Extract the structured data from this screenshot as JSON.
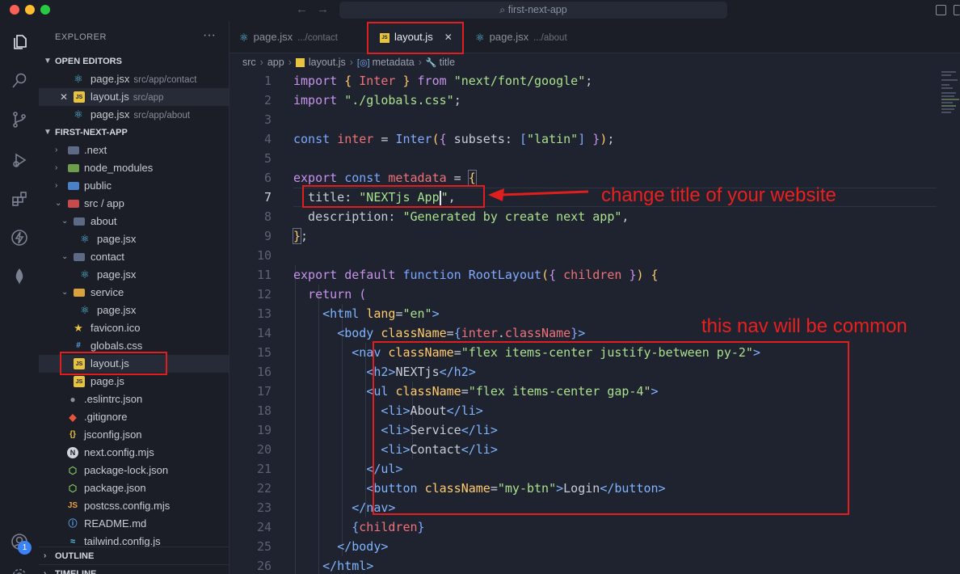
{
  "window": {
    "search_text": "first-next-app"
  },
  "activity_bar": {
    "icons": [
      "explorer-icon",
      "search-icon",
      "source-control-icon",
      "run-debug-icon",
      "extensions-icon",
      "thunder-icon",
      "mongodb-icon",
      "account-icon",
      "settings-icon"
    ],
    "badge": "1"
  },
  "explorer": {
    "title": "EXPLORER",
    "more": "···",
    "open_editors": {
      "label": "OPEN EDITORS",
      "items": [
        {
          "name": "page.jsx",
          "path": "src/app/contact"
        },
        {
          "name": "layout.js",
          "path": "src/app"
        },
        {
          "name": "page.jsx",
          "path": "src/app/about"
        }
      ]
    },
    "project": {
      "label": "FIRST-NEXT-APP",
      "items": [
        {
          "name": ".next"
        },
        {
          "name": "node_modules"
        },
        {
          "name": "public"
        },
        {
          "name": "src / app"
        },
        {
          "name": "about"
        },
        {
          "name": "page.jsx"
        },
        {
          "name": "contact"
        },
        {
          "name": "page.jsx"
        },
        {
          "name": "service"
        },
        {
          "name": "page.jsx"
        },
        {
          "name": "favicon.ico"
        },
        {
          "name": "globals.css"
        },
        {
          "name": "layout.js"
        },
        {
          "name": "page.js"
        },
        {
          "name": ".eslintrc.json"
        },
        {
          "name": ".gitignore"
        },
        {
          "name": "jsconfig.json"
        },
        {
          "name": "next.config.mjs"
        },
        {
          "name": "package-lock.json"
        },
        {
          "name": "package.json"
        },
        {
          "name": "postcss.config.mjs"
        },
        {
          "name": "README.md"
        },
        {
          "name": "tailwind.config.js"
        }
      ]
    },
    "outline_label": "OUTLINE",
    "timeline_label": "TIMELINE"
  },
  "tabs": [
    {
      "name": "page.jsx",
      "sub": ".../contact"
    },
    {
      "name": "layout.js",
      "close": "✕"
    },
    {
      "name": "page.jsx",
      "sub": ".../about"
    }
  ],
  "breadcrumb": [
    "src",
    "app",
    "layout.js",
    "metadata",
    "title"
  ],
  "editor": {
    "line_numbers": [
      "1",
      "2",
      "3",
      "4",
      "5",
      "6",
      "7",
      "8",
      "9",
      "10",
      "11",
      "12",
      "13",
      "14",
      "15",
      "16",
      "17",
      "18",
      "19",
      "20",
      "21",
      "22",
      "23",
      "24",
      "25",
      "26"
    ],
    "current_line": "7"
  },
  "annotations": {
    "title_note": "change title of your website",
    "nav_note": "this nav will be common"
  }
}
